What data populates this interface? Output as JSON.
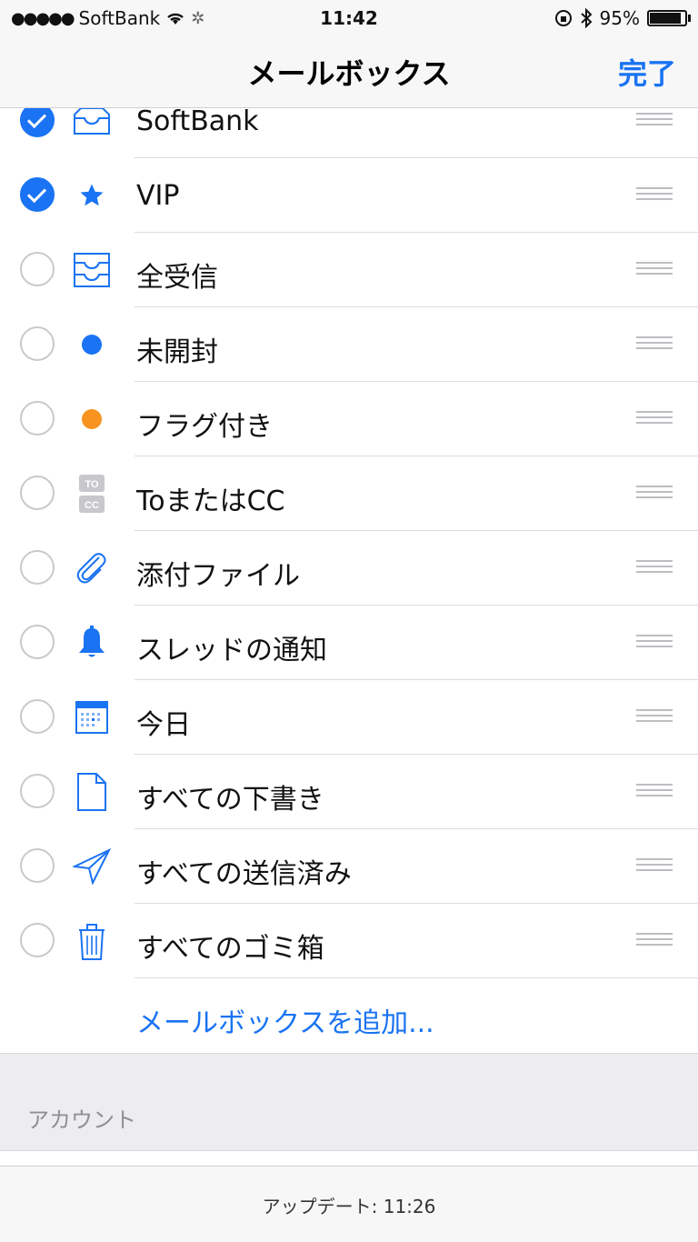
{
  "status_bar": {
    "signal_dots": "●●●●●",
    "carrier": "SoftBank",
    "time": "11:42",
    "battery_percent": "95%",
    "battery_level": 0.95
  },
  "nav": {
    "title": "メールボックス",
    "done_label": "完了"
  },
  "mailboxes": [
    {
      "label": "SoftBank",
      "checked": true,
      "icon": "inbox-icon"
    },
    {
      "label": "VIP",
      "checked": true,
      "icon": "star-icon"
    },
    {
      "label": "全受信",
      "checked": false,
      "icon": "all-inboxes-icon"
    },
    {
      "label": "未開封",
      "checked": false,
      "icon": "unread-dot-icon"
    },
    {
      "label": "フラグ付き",
      "checked": false,
      "icon": "flag-dot-icon"
    },
    {
      "label": "ToまたはCC",
      "checked": false,
      "icon": "to-cc-icon"
    },
    {
      "label": "添付ファイル",
      "checked": false,
      "icon": "paperclip-icon"
    },
    {
      "label": "スレッドの通知",
      "checked": false,
      "icon": "bell-icon"
    },
    {
      "label": "今日",
      "checked": false,
      "icon": "calendar-icon"
    },
    {
      "label": "すべての下書き",
      "checked": false,
      "icon": "draft-document-icon"
    },
    {
      "label": "すべての送信済み",
      "checked": false,
      "icon": "paper-plane-icon"
    },
    {
      "label": "すべてのゴミ箱",
      "checked": false,
      "icon": "trash-icon"
    }
  ],
  "add_mailbox_label": "メールボックスを追加...",
  "accounts_header": "アカウント",
  "footer": {
    "updated_text": "アップデート: 11:26"
  },
  "icons": {
    "to_label": "TO",
    "cc_label": "CC"
  },
  "colors": {
    "accent": "#1a73f2",
    "orange": "#f7931e",
    "gray_icon": "#c7c7cc"
  }
}
